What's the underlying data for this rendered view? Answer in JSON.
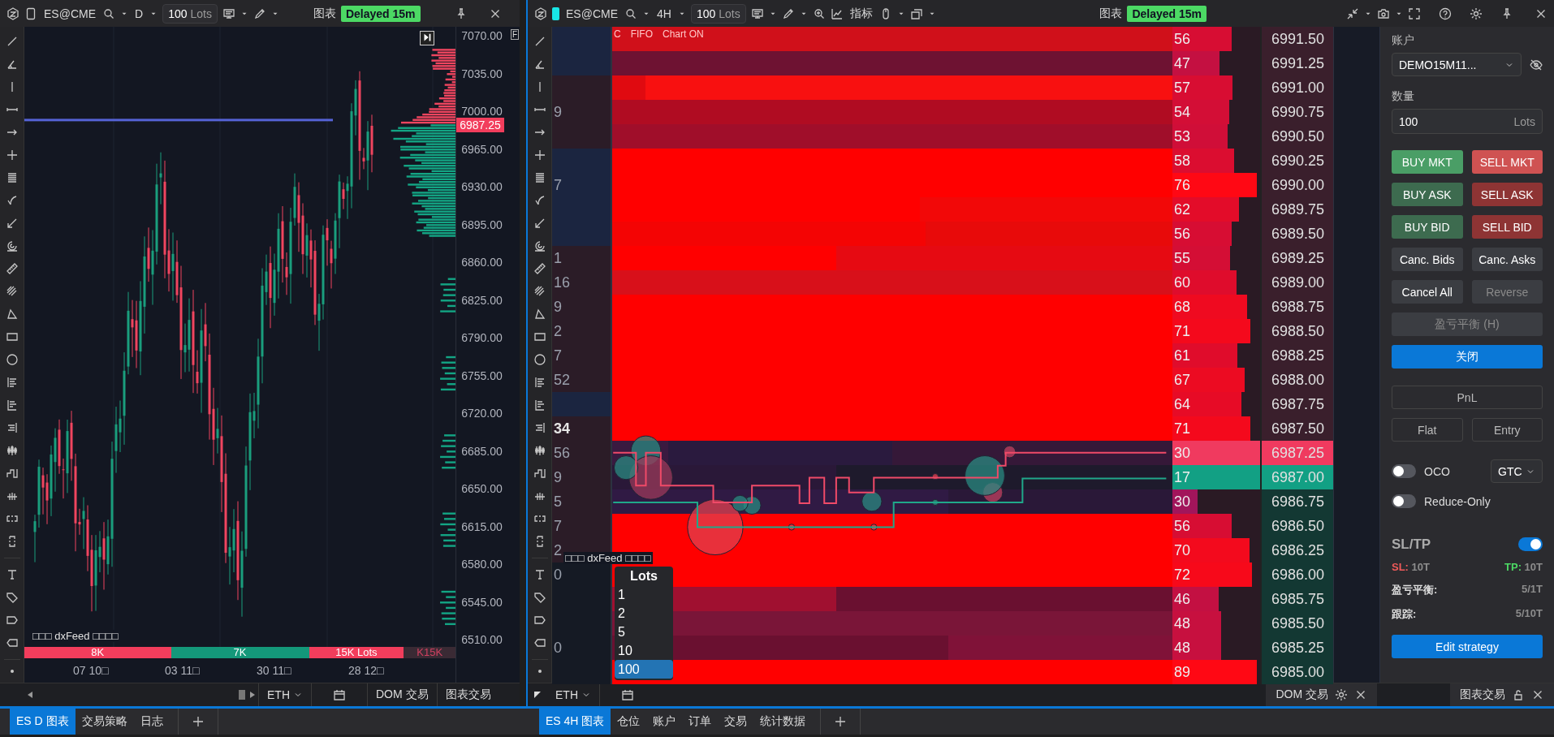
{
  "left_window": {
    "toolbar": {
      "symbol": "ES@CME",
      "timeframe": "D",
      "quantity": "100",
      "quantity_unit": "Lots",
      "chart_label": "图表",
      "status_badge": "Delayed 15m"
    },
    "chart": {
      "corner_label": "F",
      "price_labels": [
        "7070.00",
        "7035.00",
        "7000.00",
        "6965.00",
        "6930.00",
        "6895.00",
        "6860.00",
        "6825.00",
        "6790.00",
        "6755.00",
        "6720.00",
        "6685.00",
        "6650.00",
        "6615.00",
        "6580.00",
        "6545.00",
        "6510.00"
      ],
      "current_price": "6987.25",
      "feed_note": "□□□ dxFeed □□□□",
      "volume_segments": [
        {
          "label": "8K",
          "kind": "sell"
        },
        {
          "label": "7K",
          "kind": "buy"
        },
        {
          "label": "15K Lots",
          "kind": "total"
        },
        {
          "label": "K15K",
          "kind": "overlap"
        }
      ],
      "date_labels": [
        "07 10□",
        "03 11□",
        "30 11□",
        "28 12□"
      ]
    },
    "footer": {
      "session": "ETH",
      "buttons": [
        "DOM 交易",
        "图表交易"
      ]
    }
  },
  "right_window": {
    "toolbar": {
      "symbol": "ES@CME",
      "timeframe": "4H",
      "quantity": "100",
      "quantity_unit": "Lots",
      "indicators_label": "指标",
      "chart_label": "图表",
      "status_badge": "Delayed 15m"
    },
    "heatmap": {
      "status": [
        "C",
        "FIFO",
        "Chart ON"
      ],
      "feed_note": "□□□ dxFeed □□□□",
      "lots_menu": {
        "title": "Lots",
        "items": [
          {
            "label": "1",
            "selected": false
          },
          {
            "label": "2",
            "selected": false
          },
          {
            "label": "5",
            "selected": false
          },
          {
            "label": "10",
            "selected": false
          },
          {
            "label": "100",
            "selected": true
          }
        ]
      }
    },
    "ladder": [
      {
        "price": "6991.50",
        "volume": "56",
        "level": 0.7,
        "kind": "ask"
      },
      {
        "price": "6991.25",
        "volume": "47",
        "level": 0.56,
        "kind": "ask"
      },
      {
        "price": "6991.00",
        "volume": "57",
        "level": 0.71,
        "kind": "ask"
      },
      {
        "price": "6990.75",
        "volume": "54",
        "level": 0.67,
        "kind": "ask",
        "left_value": {
          "text": "9",
          "bold": false
        }
      },
      {
        "price": "6990.50",
        "volume": "53",
        "level": 0.65,
        "kind": "ask"
      },
      {
        "price": "6990.25",
        "volume": "58",
        "level": 0.73,
        "kind": "ask"
      },
      {
        "price": "6990.00",
        "volume": "76",
        "level": 1,
        "kind": "ask",
        "left_value": {
          "text": "7",
          "bold": false
        }
      },
      {
        "price": "6989.75",
        "volume": "62",
        "level": 0.79,
        "kind": "ask"
      },
      {
        "price": "6989.50",
        "volume": "56",
        "level": 0.7,
        "kind": "ask"
      },
      {
        "price": "6989.25",
        "volume": "55",
        "level": 0.68,
        "kind": "ask",
        "left_value": {
          "text": "1",
          "bold": false
        }
      },
      {
        "price": "6989.00",
        "volume": "60",
        "level": 0.76,
        "kind": "ask",
        "left_value": {
          "text": "16",
          "bold": false
        }
      },
      {
        "price": "6988.75",
        "volume": "68",
        "level": 0.88,
        "kind": "ask",
        "left_value": {
          "text": "9",
          "bold": false
        }
      },
      {
        "price": "6988.50",
        "volume": "71",
        "level": 0.92,
        "kind": "ask",
        "left_value": {
          "text": "2",
          "bold": false
        }
      },
      {
        "price": "6988.25",
        "volume": "61",
        "level": 0.77,
        "kind": "ask",
        "left_value": {
          "text": "7",
          "bold": false
        }
      },
      {
        "price": "6988.00",
        "volume": "67",
        "level": 0.86,
        "kind": "ask",
        "left_value": {
          "text": "52",
          "bold": false
        }
      },
      {
        "price": "6987.75",
        "volume": "64",
        "level": 0.82,
        "kind": "ask"
      },
      {
        "price": "6987.50",
        "volume": "71",
        "level": 0.92,
        "kind": "ask",
        "left_value": {
          "text": "34",
          "bold": true
        }
      },
      {
        "price": "6987.25",
        "volume": "30",
        "level": 0.3,
        "kind": "best_ask",
        "left_value": {
          "text": "56",
          "bold": false
        }
      },
      {
        "price": "6987.00",
        "volume": "17",
        "level": 0.11,
        "kind": "best_bid",
        "left_value": {
          "text": "9",
          "bold": false
        }
      },
      {
        "price": "6986.75",
        "volume": "30",
        "level": 0.3,
        "kind": "bid",
        "left_value": {
          "text": "5",
          "bold": false
        }
      },
      {
        "price": "6986.50",
        "volume": "56",
        "level": 0.7,
        "kind": "bid",
        "left_value": {
          "text": "7",
          "bold": false
        }
      },
      {
        "price": "6986.25",
        "volume": "70",
        "level": 0.91,
        "kind": "bid",
        "left_value": {
          "text": "2",
          "bold": false
        }
      },
      {
        "price": "6986.00",
        "volume": "72",
        "level": 0.94,
        "kind": "bid",
        "left_value": {
          "text": "0",
          "bold": false
        }
      },
      {
        "price": "6985.75",
        "volume": "46",
        "level": 0.55,
        "kind": "bid"
      },
      {
        "price": "6985.50",
        "volume": "48",
        "level": 0.58,
        "kind": "bid"
      },
      {
        "price": "6985.25",
        "volume": "48",
        "level": 0.58,
        "kind": "bid",
        "left_value": {
          "text": "0",
          "bold": false
        }
      },
      {
        "price": "6985.00",
        "volume": "89",
        "level": 1,
        "kind": "bid"
      }
    ],
    "footer": {
      "session": "ETH",
      "panels": [
        {
          "label": "DOM 交易",
          "kind": "settings"
        },
        {
          "label": "图表交易",
          "kind": "lock"
        }
      ]
    }
  },
  "trade_panel": {
    "account_label": "账户",
    "account": "DEMO15M11...",
    "quantity_label": "数量",
    "quantity": "100",
    "quantity_unit": "Lots",
    "order_buttons": [
      {
        "label": "BUY MKT",
        "kind": "buy_market",
        "disabled": false
      },
      {
        "label": "SELL MKT",
        "kind": "sell_market",
        "disabled": false
      },
      {
        "label": "BUY ASK",
        "kind": "buy",
        "disabled": false
      },
      {
        "label": "SELL ASK",
        "kind": "sell",
        "disabled": false
      },
      {
        "label": "BUY BID",
        "kind": "buy",
        "disabled": false
      },
      {
        "label": "SELL BID",
        "kind": "sell",
        "disabled": false
      },
      {
        "label": "Canc. Bids",
        "kind": "neutral",
        "disabled": false
      },
      {
        "label": "Canc. Asks",
        "kind": "neutral",
        "disabled": false
      },
      {
        "label": "Cancel All",
        "kind": "neutral",
        "disabled": false
      },
      {
        "label": "Reverse",
        "kind": "neutral",
        "disabled": true
      }
    ],
    "breakeven_button": {
      "label": "盈亏平衡 (H)",
      "disabled": true
    },
    "close_button": "关闭",
    "pnl_button": "PnL",
    "flat_button": "Flat",
    "entry_button": "Entry",
    "oco": {
      "label": "OCO",
      "on": false
    },
    "time_in_force": "GTC",
    "reduce_only": {
      "label": "Reduce-Only",
      "on": false
    },
    "sltp": {
      "title": "SL/TP",
      "on": true,
      "sl_label": "SL:",
      "sl_value": "10T",
      "tp_label": "TP:",
      "tp_value": "10T",
      "rows": [
        {
          "label": "盈亏平衡:",
          "value": "5/1T"
        },
        {
          "label": "跟踪:",
          "value": "5/10T"
        }
      ]
    },
    "edit_button": "Edit strategy"
  },
  "left_tabs": [
    {
      "label": "ES D 图表",
      "selected": true
    },
    {
      "label": "交易策略",
      "selected": false
    },
    {
      "label": "日志",
      "selected": false
    }
  ],
  "right_tabs": [
    {
      "label": "ES 4H 图表",
      "selected": true
    },
    {
      "label": "仓位",
      "selected": false
    },
    {
      "label": "账户",
      "selected": false
    },
    {
      "label": "订单",
      "selected": false
    },
    {
      "label": "交易",
      "selected": false
    },
    {
      "label": "统计数据",
      "selected": false
    }
  ]
}
